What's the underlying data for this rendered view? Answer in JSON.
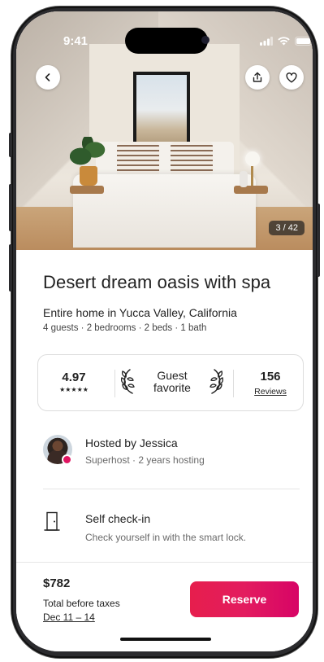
{
  "status_bar": {
    "time": "9:41"
  },
  "gallery": {
    "counter": "3 / 42"
  },
  "listing": {
    "title": "Desert dream oasis with spa",
    "subtitle": "Entire home in Yucca Valley, California",
    "details": "4 guests · 2 bedrooms · 2 beds · 1 bath"
  },
  "rating_card": {
    "rating": "4.97",
    "stars": "★★★★★",
    "badge_line1": "Guest",
    "badge_line2": "favorite",
    "reviews_count": "156",
    "reviews_label": "Reviews"
  },
  "host": {
    "name": "Hosted by Jessica",
    "subtitle": "Superhost · 2 years hosting"
  },
  "amenity": {
    "title": "Self check-in",
    "subtitle": "Check yourself in with the smart lock."
  },
  "footer": {
    "price": "$782",
    "price_note": "Total before taxes",
    "dates": "Dec 11 – 14",
    "reserve_label": "Reserve"
  },
  "colors": {
    "accent": "#e31c5f",
    "text": "#222222",
    "muted": "#6a6a6a"
  },
  "icons": [
    "back-chevron-icon",
    "share-icon",
    "heart-icon",
    "laurel-icon",
    "door-icon",
    "signal-icon",
    "wifi-icon",
    "battery-icon"
  ]
}
